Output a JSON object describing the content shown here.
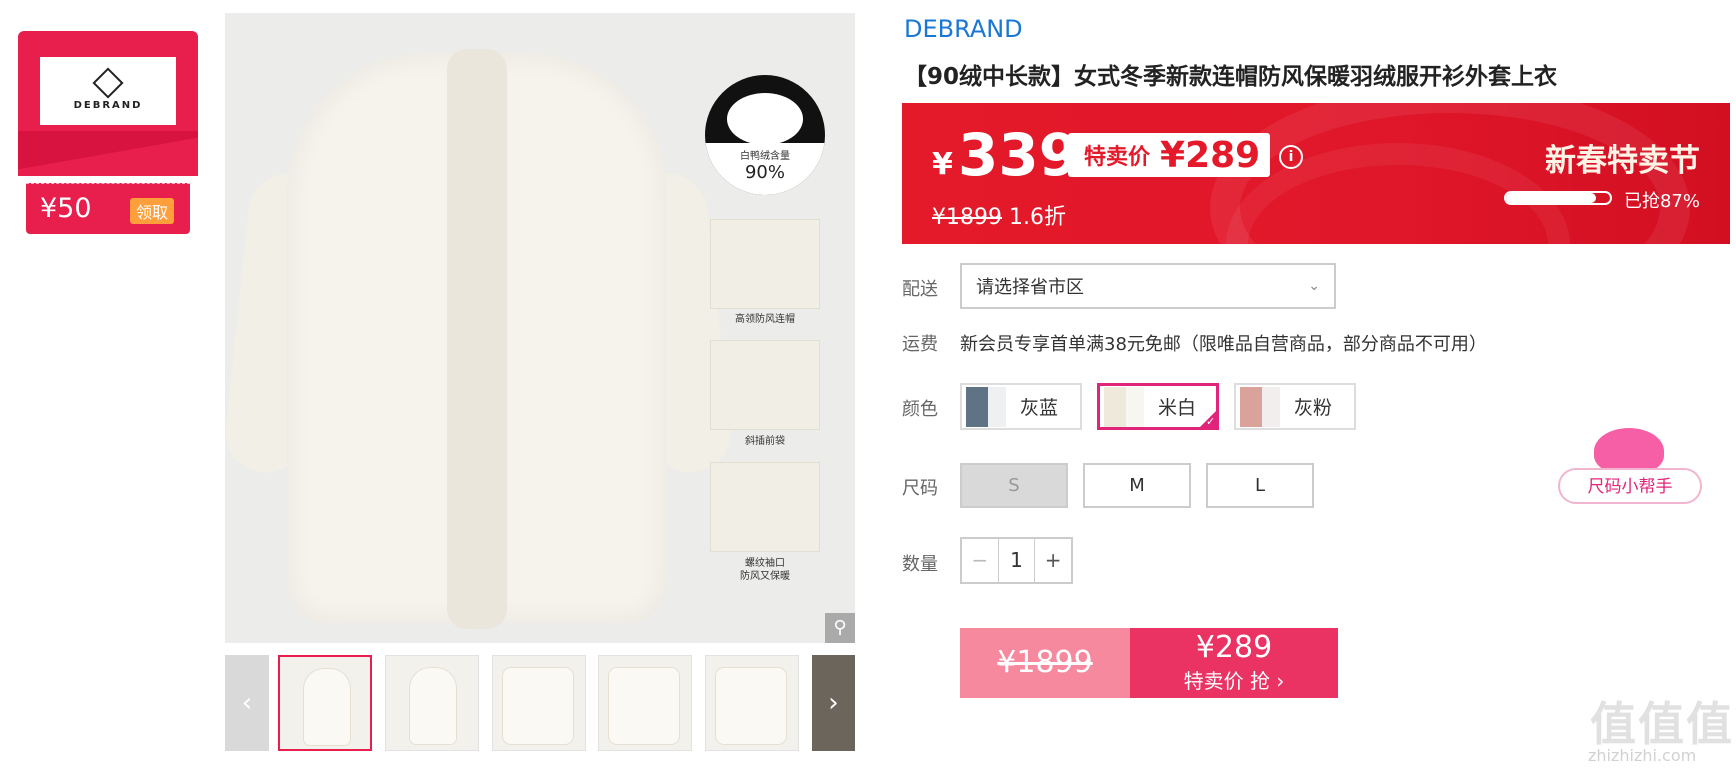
{
  "coupon": {
    "amount": "¥50",
    "claim_label": "领取",
    "brand_logo_text": "DEBRAND"
  },
  "gallery": {
    "down_label": "白鸭绒含量",
    "down_percent": "90%",
    "detail_captions": [
      "高领防风连帽",
      "斜插前袋",
      "螺纹袖口\n防风又保暖"
    ],
    "zoom_icon": "magnifier-icon",
    "prev_icon": "chevron-left-icon",
    "next_icon": "chevron-right-icon"
  },
  "product": {
    "brand": "DEBRAND",
    "title": "【90绒中长款】女式冬季新款连帽防风保暖羽绒服开衫外套上衣"
  },
  "price": {
    "currency": "¥",
    "current": "339",
    "special_label": "特卖价",
    "special_price": "¥289",
    "original": "¥1899",
    "discount": "1.6折",
    "festival": "新春特卖节",
    "sold_label": "已抢87%",
    "sold_fraction": 0.87
  },
  "delivery": {
    "label": "配送",
    "placeholder": "请选择省市区"
  },
  "shipping": {
    "label": "运费",
    "text": "新会员专享首单满38元免邮（限唯品自营商品，部分商品不可用）"
  },
  "colors": {
    "label": "颜色",
    "options": [
      "灰蓝",
      "米白",
      "灰粉"
    ],
    "selected": "米白"
  },
  "sizes": {
    "label": "尺码",
    "options": [
      "S",
      "M",
      "L"
    ]
  },
  "quantity": {
    "label": "数量",
    "value": "1",
    "minus": "−",
    "plus": "+"
  },
  "buy": {
    "original": "¥1899",
    "price": "¥289",
    "action": "特卖价 抢 ›"
  },
  "size_helper": {
    "label": "尺码小帮手"
  },
  "watermark": {
    "text": "值值值",
    "sub": "zhizhizhi.com"
  }
}
